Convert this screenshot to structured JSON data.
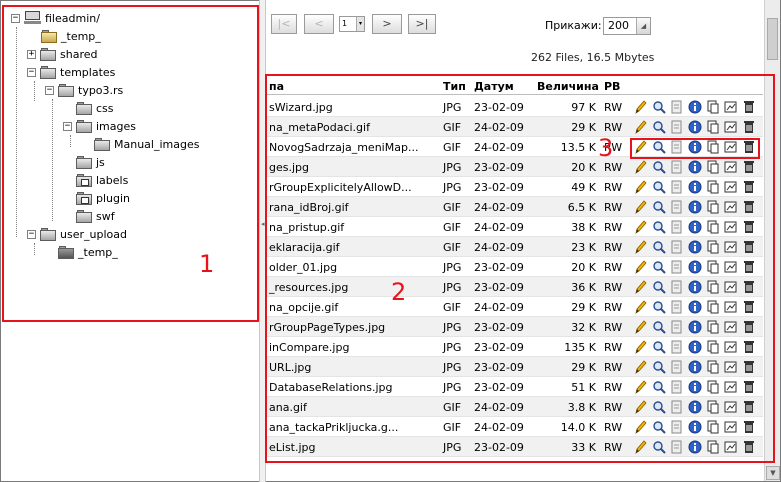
{
  "tree": {
    "root": "fileadmin/",
    "items": [
      {
        "label": "_temp_",
        "icon": "locked-folder-icon"
      },
      {
        "label": "shared",
        "icon": "folder-icon"
      },
      {
        "label": "templates",
        "icon": "folder-icon"
      },
      {
        "label": "typo3.rs",
        "icon": "folder-icon"
      },
      {
        "label": "css",
        "icon": "folder-icon"
      },
      {
        "label": "images",
        "icon": "folder-icon"
      },
      {
        "label": "Manual_images",
        "icon": "folder-icon"
      },
      {
        "label": "js",
        "icon": "folder-icon"
      },
      {
        "label": "labels",
        "icon": "special-folder-icon"
      },
      {
        "label": "plugin",
        "icon": "special-folder-icon"
      },
      {
        "label": "swf",
        "icon": "folder-icon"
      },
      {
        "label": "user_upload",
        "icon": "folder-icon"
      },
      {
        "label": "_temp_",
        "icon": "dark-folder-icon"
      }
    ]
  },
  "toolbar": {
    "first": "|<",
    "prev": "<",
    "page": "1",
    "next": ">",
    "last": ">|",
    "show_label": "Прикажи:",
    "show_value": "200"
  },
  "summary": "262 Files, 16.5 Mbytes",
  "table": {
    "headers": {
      "name": "па",
      "type": "Тип",
      "date": "Датум",
      "size": "Величина",
      "perm": "РВ"
    },
    "rows": [
      {
        "name": "sWizard.jpg",
        "type": "JPG",
        "date": "23-02-09",
        "size": "97 K",
        "perm": "RW"
      },
      {
        "name": "na_metaPodaci.gif",
        "type": "GIF",
        "date": "24-02-09",
        "size": "29 K",
        "perm": "RW"
      },
      {
        "name": "NovogSadrzaja_meniMap...",
        "type": "GIF",
        "date": "24-02-09",
        "size": "13.5 K",
        "perm": "RW"
      },
      {
        "name": "ges.jpg",
        "type": "JPG",
        "date": "23-02-09",
        "size": "20 K",
        "perm": "RW"
      },
      {
        "name": "rGroupExplicitelyAllowD...",
        "type": "JPG",
        "date": "23-02-09",
        "size": "49 K",
        "perm": "RW"
      },
      {
        "name": "rana_idBroj.gif",
        "type": "GIF",
        "date": "24-02-09",
        "size": "6.5 K",
        "perm": "RW"
      },
      {
        "name": "na_pristup.gif",
        "type": "GIF",
        "date": "24-02-09",
        "size": "38 K",
        "perm": "RW"
      },
      {
        "name": "eklaracija.gif",
        "type": "GIF",
        "date": "24-02-09",
        "size": "23 K",
        "perm": "RW"
      },
      {
        "name": "older_01.jpg",
        "type": "JPG",
        "date": "23-02-09",
        "size": "20 K",
        "perm": "RW"
      },
      {
        "name": "_resources.jpg",
        "type": "JPG",
        "date": "23-02-09",
        "size": "36 K",
        "perm": "RW"
      },
      {
        "name": "na_opcije.gif",
        "type": "GIF",
        "date": "24-02-09",
        "size": "29 K",
        "perm": "RW"
      },
      {
        "name": "rGroupPageTypes.jpg",
        "type": "JPG",
        "date": "23-02-09",
        "size": "32 K",
        "perm": "RW"
      },
      {
        "name": "inCompare.jpg",
        "type": "JPG",
        "date": "23-02-09",
        "size": "135 K",
        "perm": "RW"
      },
      {
        "name": "URL.jpg",
        "type": "JPG",
        "date": "23-02-09",
        "size": "29 K",
        "perm": "RW"
      },
      {
        "name": "DatabaseRelations.jpg",
        "type": "JPG",
        "date": "23-02-09",
        "size": "51 K",
        "perm": "RW"
      },
      {
        "name": "ana.gif",
        "type": "GIF",
        "date": "24-02-09",
        "size": "3.8 K",
        "perm": "RW"
      },
      {
        "name": "ana_tackaPrikljucka.g...",
        "type": "GIF",
        "date": "24-02-09",
        "size": "14.0 K",
        "perm": "RW"
      },
      {
        "name": "eList.jpg",
        "type": "JPG",
        "date": "23-02-09",
        "size": "33 K",
        "perm": "RW"
      }
    ]
  },
  "annotations": {
    "a1": "1",
    "a2": "2",
    "a3": "3"
  },
  "colors": {
    "annotation": "#e8131a"
  }
}
